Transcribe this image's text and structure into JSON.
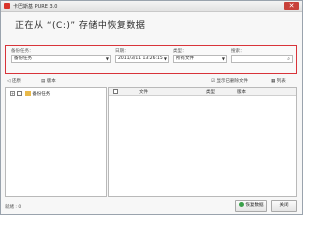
{
  "window": {
    "title": "卡巴斯基 PURE 3.0",
    "close_label": "✕"
  },
  "heading": "正在从 “(C:)” 存储中恢复数据",
  "filters": {
    "task_label": "备份任务：",
    "task_value": "备份任务",
    "date_label": "日期：",
    "date_value": "2011/3/11 13:26:15",
    "category_label": "类型：",
    "category_value": "所有文件",
    "search_label": "搜索：",
    "search_value": ""
  },
  "toolbar": {
    "back_label": "◁ 还原",
    "versions_label": "版本",
    "show_deleted_label": "显示已删除文件",
    "list_label": "列表"
  },
  "tree": {
    "root_label": "备份任务"
  },
  "list": {
    "columns": [
      "文件",
      "类型",
      "版本"
    ]
  },
  "status": "就绪 : 0",
  "buttons": {
    "restore_label": "恢复数据",
    "close_label": "关闭"
  },
  "colors": {
    "highlight_border": "#d8343a",
    "accent_icon": "#d9342b"
  }
}
